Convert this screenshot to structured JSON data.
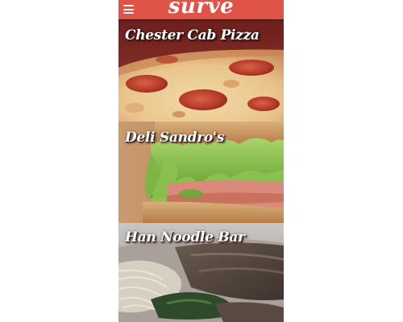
{
  "app": {
    "brand": "surve",
    "colors": {
      "app_bar": "#e05348",
      "title_text": "#ffffff"
    },
    "menu_icon": "hamburger-menu-icon"
  },
  "restaurants": [
    {
      "name": "Chester Cab Pizza",
      "image": "pepperoni-pizza-photo"
    },
    {
      "name": "Deli Sandro's",
      "image": "deli-sandwich-photo"
    },
    {
      "name": "Han Noodle Bar",
      "image": "noodle-soup-photo"
    }
  ]
}
